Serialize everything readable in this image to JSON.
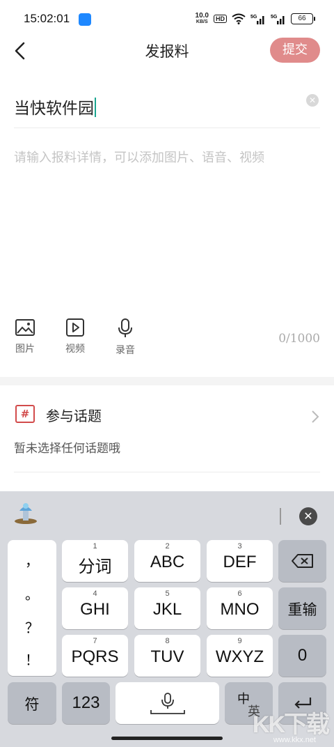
{
  "status_bar": {
    "time": "15:02:01",
    "net_speed_value": "10.0",
    "net_speed_unit": "KB/S",
    "hd_label": "HD",
    "battery": "66"
  },
  "header": {
    "title": "发报料",
    "submit_label": "提交"
  },
  "form": {
    "title_value": "当快软件园",
    "detail_placeholder": "请输入报料详情，可以添加图片、语音、视频",
    "char_count": "0/1000"
  },
  "media_tools": [
    {
      "label": "图片",
      "icon": "image-icon"
    },
    {
      "label": "视频",
      "icon": "video-icon"
    },
    {
      "label": "录音",
      "icon": "microphone-icon"
    }
  ],
  "topic": {
    "title": "参与话题",
    "subtitle": "暂未选择任何话题哦",
    "icon_symbol": "#"
  },
  "keyboard": {
    "punctuation": [
      "，",
      "。",
      "？",
      "！"
    ],
    "rows": [
      [
        {
          "num": "1",
          "label": "分词"
        },
        {
          "num": "2",
          "label": "ABC"
        },
        {
          "num": "3",
          "label": "DEF"
        }
      ],
      [
        {
          "num": "4",
          "label": "GHI"
        },
        {
          "num": "5",
          "label": "JKL"
        },
        {
          "num": "6",
          "label": "MNO"
        }
      ],
      [
        {
          "num": "7",
          "label": "PQRS"
        },
        {
          "num": "8",
          "label": "TUV"
        },
        {
          "num": "9",
          "label": "WXYZ"
        }
      ]
    ],
    "reenter_label": "重输",
    "zero_label": "0",
    "symbol_label": "符",
    "number_label": "123",
    "lang_top": "中",
    "lang_bottom": "英"
  },
  "watermark": {
    "text": "KK下载",
    "url": "www.kkx.net"
  },
  "colors": {
    "submit_bg": "#e08b8b",
    "caret": "#1aa58f",
    "topic_icon": "#d24b4b",
    "keyboard_bg": "#d7d9de"
  }
}
